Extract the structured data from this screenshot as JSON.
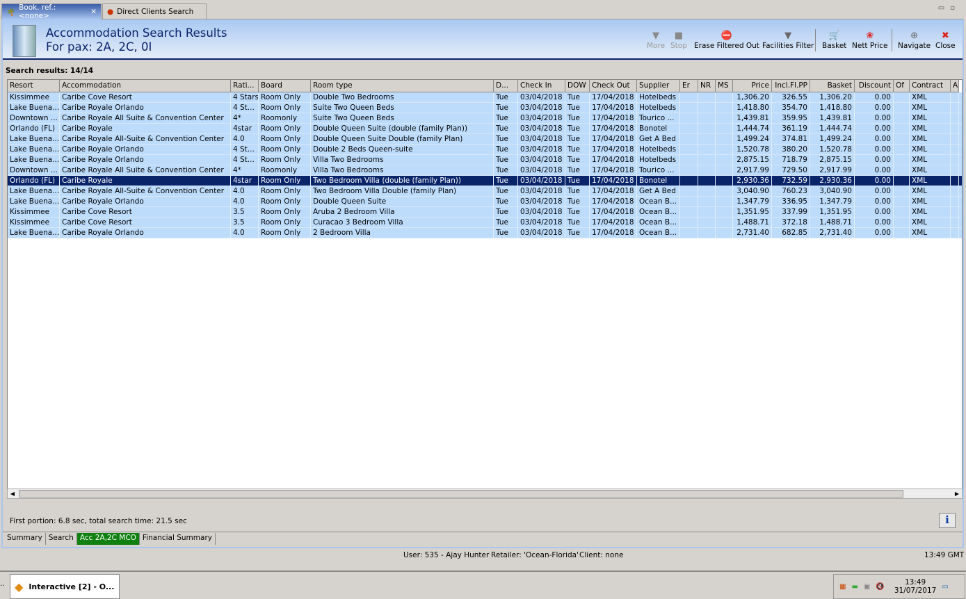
{
  "tabs": [
    {
      "label": "Book. ref.: <none>",
      "icon": "palm-tree-icon"
    },
    {
      "label": "Direct Clients Search",
      "icon": "client-icon"
    }
  ],
  "header": {
    "title": "Accommodation Search Results",
    "subtitle": "For pax: 2A, 2C, 0I"
  },
  "toolbar": [
    {
      "label": "More",
      "icon": "triangle-down-icon",
      "glyph": "▼",
      "disabled": true
    },
    {
      "label": "Stop",
      "icon": "stop-icon",
      "glyph": "■",
      "disabled": true
    },
    {
      "label": "Erase Filtered Out",
      "icon": "erase-icon",
      "glyph": "⛔"
    },
    {
      "label": "Facilities Filter",
      "icon": "funnel-icon",
      "glyph": "▼"
    },
    {
      "label": "Basket",
      "icon": "cart-icon",
      "glyph": "🛒"
    },
    {
      "label": "Nett Price",
      "icon": "price-icon",
      "glyph": "❀"
    },
    {
      "label": "Navigate",
      "icon": "compass-icon",
      "glyph": "⊕"
    },
    {
      "label": "Close",
      "icon": "close-icon",
      "glyph": "✖"
    }
  ],
  "results_label": "Search results: 14/14",
  "columns": [
    "Resort",
    "Accommodation",
    "Rati...",
    "Board",
    "Room type",
    "D...",
    "Check In",
    "DOW",
    "Check Out",
    "Supplier",
    "Er",
    "NR",
    "MS",
    "Price",
    "Incl.Fl.PP",
    "Basket",
    "Discount",
    "Of",
    "Contract",
    "A"
  ],
  "rows": [
    [
      "Kissimmee",
      "Caribe Cove Resort",
      "4 Stars",
      "Room Only",
      "Double Two Bedrooms",
      "Tue",
      "03/04/2018",
      "Tue",
      "17/04/2018",
      "Hotelbeds",
      "",
      "",
      "",
      "1,306.20",
      "326.55",
      "1,306.20",
      "0.00",
      "",
      "XML",
      ""
    ],
    [
      "Lake Buena...",
      "Caribe Royale Orlando",
      "4 St...",
      "Room Only",
      "Suite Two Queen Beds",
      "Tue",
      "03/04/2018",
      "Tue",
      "17/04/2018",
      "Hotelbeds",
      "",
      "",
      "",
      "1,418.80",
      "354.70",
      "1,418.80",
      "0.00",
      "",
      "XML",
      ""
    ],
    [
      "Downtown ...",
      "Caribe Royale All Suite & Convention Center",
      "4*",
      "Roomonly",
      "Suite Two Queen Beds",
      "Tue",
      "03/04/2018",
      "Tue",
      "17/04/2018",
      "Tourico ...",
      "",
      "",
      "",
      "1,439.81",
      "359.95",
      "1,439.81",
      "0.00",
      "",
      "XML",
      ""
    ],
    [
      "Orlando (FL)",
      "Caribe Royale",
      "4star",
      "Room Only",
      "Double Queen Suite (double (family Plan))",
      "Tue",
      "03/04/2018",
      "Tue",
      "17/04/2018",
      "Bonotel",
      "",
      "",
      "",
      "1,444.74",
      "361.19",
      "1,444.74",
      "0.00",
      "",
      "XML",
      ""
    ],
    [
      "Lake Buena...",
      "Caribe Royale All-Suite & Convention Center",
      "4.0",
      "Room Only",
      "Double Queen Suite Double (family Plan)",
      "Tue",
      "03/04/2018",
      "Tue",
      "17/04/2018",
      "Get A Bed",
      "",
      "",
      "",
      "1,499.24",
      "374.81",
      "1,499.24",
      "0.00",
      "",
      "XML",
      ""
    ],
    [
      "Lake Buena...",
      "Caribe Royale Orlando",
      "4 St...",
      "Room Only",
      "Double 2 Beds Queen-suite",
      "Tue",
      "03/04/2018",
      "Tue",
      "17/04/2018",
      "Hotelbeds",
      "",
      "",
      "",
      "1,520.78",
      "380.20",
      "1,520.78",
      "0.00",
      "",
      "XML",
      ""
    ],
    [
      "Lake Buena...",
      "Caribe Royale Orlando",
      "4 St...",
      "Room Only",
      "Villa Two Bedrooms",
      "Tue",
      "03/04/2018",
      "Tue",
      "17/04/2018",
      "Hotelbeds",
      "",
      "",
      "",
      "2,875.15",
      "718.79",
      "2,875.15",
      "0.00",
      "",
      "XML",
      ""
    ],
    [
      "Downtown ...",
      "Caribe Royale All Suite & Convention Center",
      "4*",
      "Roomonly",
      "Villa Two Bedrooms",
      "Tue",
      "03/04/2018",
      "Tue",
      "17/04/2018",
      "Tourico ...",
      "",
      "",
      "",
      "2,917.99",
      "729.50",
      "2,917.99",
      "0.00",
      "",
      "XML",
      ""
    ],
    [
      "Orlando (FL)",
      "Caribe Royale",
      "4star",
      "Room Only",
      "Two Bedroom Villa (double (family Plan))",
      "Tue",
      "03/04/2018",
      "Tue",
      "17/04/2018",
      "Bonotel",
      "",
      "",
      "",
      "2,930.36",
      "732.59",
      "2,930.36",
      "0.00",
      "",
      "XML",
      ""
    ],
    [
      "Lake Buena...",
      "Caribe Royale All-Suite & Convention Center",
      "4.0",
      "Room Only",
      "Two Bedroom Villa Double (family Plan)",
      "Tue",
      "03/04/2018",
      "Tue",
      "17/04/2018",
      "Get A Bed",
      "",
      "",
      "",
      "3,040.90",
      "760.23",
      "3,040.90",
      "0.00",
      "",
      "XML",
      ""
    ],
    [
      "Lake Buena...",
      "Caribe Royale Orlando",
      "4.0",
      "Room Only",
      "Double Queen Suite",
      "Tue",
      "03/04/2018",
      "Tue",
      "17/04/2018",
      "Ocean B...",
      "",
      "",
      "",
      "1,347.79",
      "336.95",
      "1,347.79",
      "0.00",
      "",
      "XML",
      ""
    ],
    [
      "Kissimmee",
      "Caribe Cove Resort",
      "3.5",
      "Room Only",
      "Aruba 2 Bedroom Villa",
      "Tue",
      "03/04/2018",
      "Tue",
      "17/04/2018",
      "Ocean B...",
      "",
      "",
      "",
      "1,351.95",
      "337.99",
      "1,351.95",
      "0.00",
      "",
      "XML",
      ""
    ],
    [
      "Kissimmee",
      "Caribe Cove Resort",
      "3.5",
      "Room Only",
      "Curacao 3 Bedroom Villa",
      "Tue",
      "03/04/2018",
      "Tue",
      "17/04/2018",
      "Ocean B...",
      "",
      "",
      "",
      "1,488.71",
      "372.18",
      "1,488.71",
      "0.00",
      "",
      "XML",
      ""
    ],
    [
      "Lake Buena...",
      "Caribe Royale Orlando",
      "4.0",
      "Room Only",
      "2 Bedroom Villa",
      "Tue",
      "03/04/2018",
      "Tue",
      "17/04/2018",
      "Ocean B...",
      "",
      "",
      "",
      "2,731.40",
      "682.85",
      "2,731.40",
      "0.00",
      "",
      "XML",
      ""
    ]
  ],
  "selected_row": 8,
  "status": "First portion: 6.8 sec, total search time: 21.5 sec",
  "info_label": "i",
  "bottom_tabs": [
    "Summary",
    "Search",
    "Acc 2A,2C MCO",
    "Financial Summary"
  ],
  "active_bottom_tab": 2,
  "app_status": {
    "user": "User: 535 - Ajay Hunter",
    "retailer": "Retailer: 'Ocean-Florida'",
    "client": "Client: none",
    "time": "13:49 GMT"
  },
  "taskbar": {
    "task": "Interactive [2] - O...",
    "clock_time": "13:49",
    "clock_date": "31/07/2017"
  }
}
